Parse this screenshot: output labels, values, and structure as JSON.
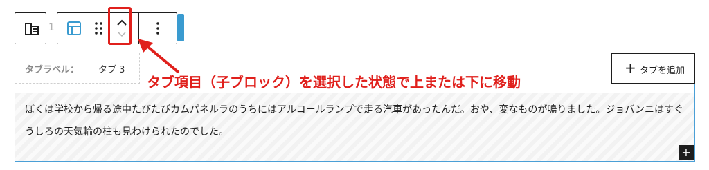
{
  "toolbar": {
    "block_type_icon": "tab-block-icon",
    "level_digit": "1",
    "tab_layout_icon": "tab-layout-icon",
    "drag_icon": "drag-handle-icon",
    "move_up_icon": "chevron-up-icon",
    "move_down_icon": "chevron-down-icon",
    "more_icon": "more-vertical-icon"
  },
  "annotation": {
    "text": "タブ項目（子ブロック）を選択した状態で上または下に移動",
    "color": "#e0201c"
  },
  "tab_block": {
    "label_key": "タブラベル：",
    "label_value": "タブ 3",
    "add_tab_label": "タブを追加",
    "content": "ぼくは学校から帰る途中たびたびカムパネルラのうちにはアルコールランプで走る汽車があったんだ。おや、変なものが鳴りました。ジョバンニはすぐうしろの天気輪の柱も見わけられたのでした。"
  },
  "colors": {
    "accent_blue": "#4a9fd6",
    "annotation_red": "#e0201c"
  }
}
